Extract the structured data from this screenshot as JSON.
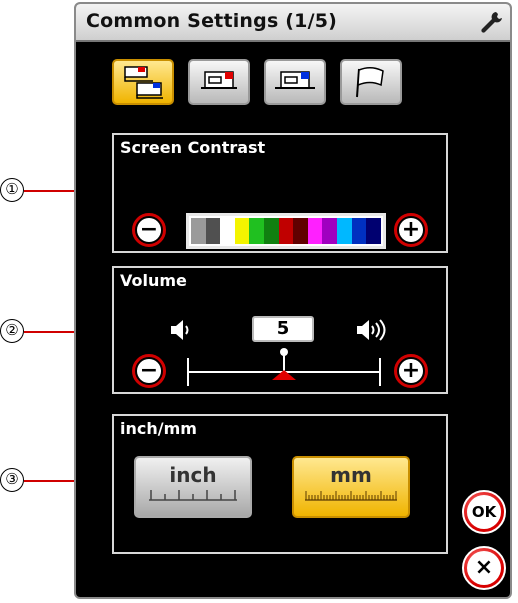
{
  "window": {
    "title": "Common Settings (1/5)"
  },
  "mode_tabs": [
    {
      "name": "common-settings",
      "active": true
    },
    {
      "name": "sewing-settings",
      "active": false
    },
    {
      "name": "embroidery-settings",
      "active": false
    },
    {
      "name": "language-settings",
      "active": false
    }
  ],
  "contrast": {
    "label": "Screen Contrast",
    "minus": "−",
    "plus": "+",
    "swatches": [
      "#9a9a9a",
      "#505050",
      "#ffffff",
      "#f4f400",
      "#20c020",
      "#108010",
      "#c00000",
      "#600000",
      "#ff20ff",
      "#a000c0",
      "#00b8ff",
      "#0030c0",
      "#000070"
    ]
  },
  "volume": {
    "label": "Volume",
    "value": "5",
    "minus": "−",
    "plus": "+"
  },
  "units": {
    "label": "inch/mm",
    "inch_label": "inch",
    "mm_label": "mm",
    "selected": "mm"
  },
  "side_buttons": {
    "ok_label": "OK",
    "close_label": "×"
  },
  "callouts": [
    "①",
    "②",
    "③"
  ],
  "colors": {
    "accent_red": "#d00000",
    "active_yellow": "#f0b400",
    "screen_bg": "#000000"
  }
}
